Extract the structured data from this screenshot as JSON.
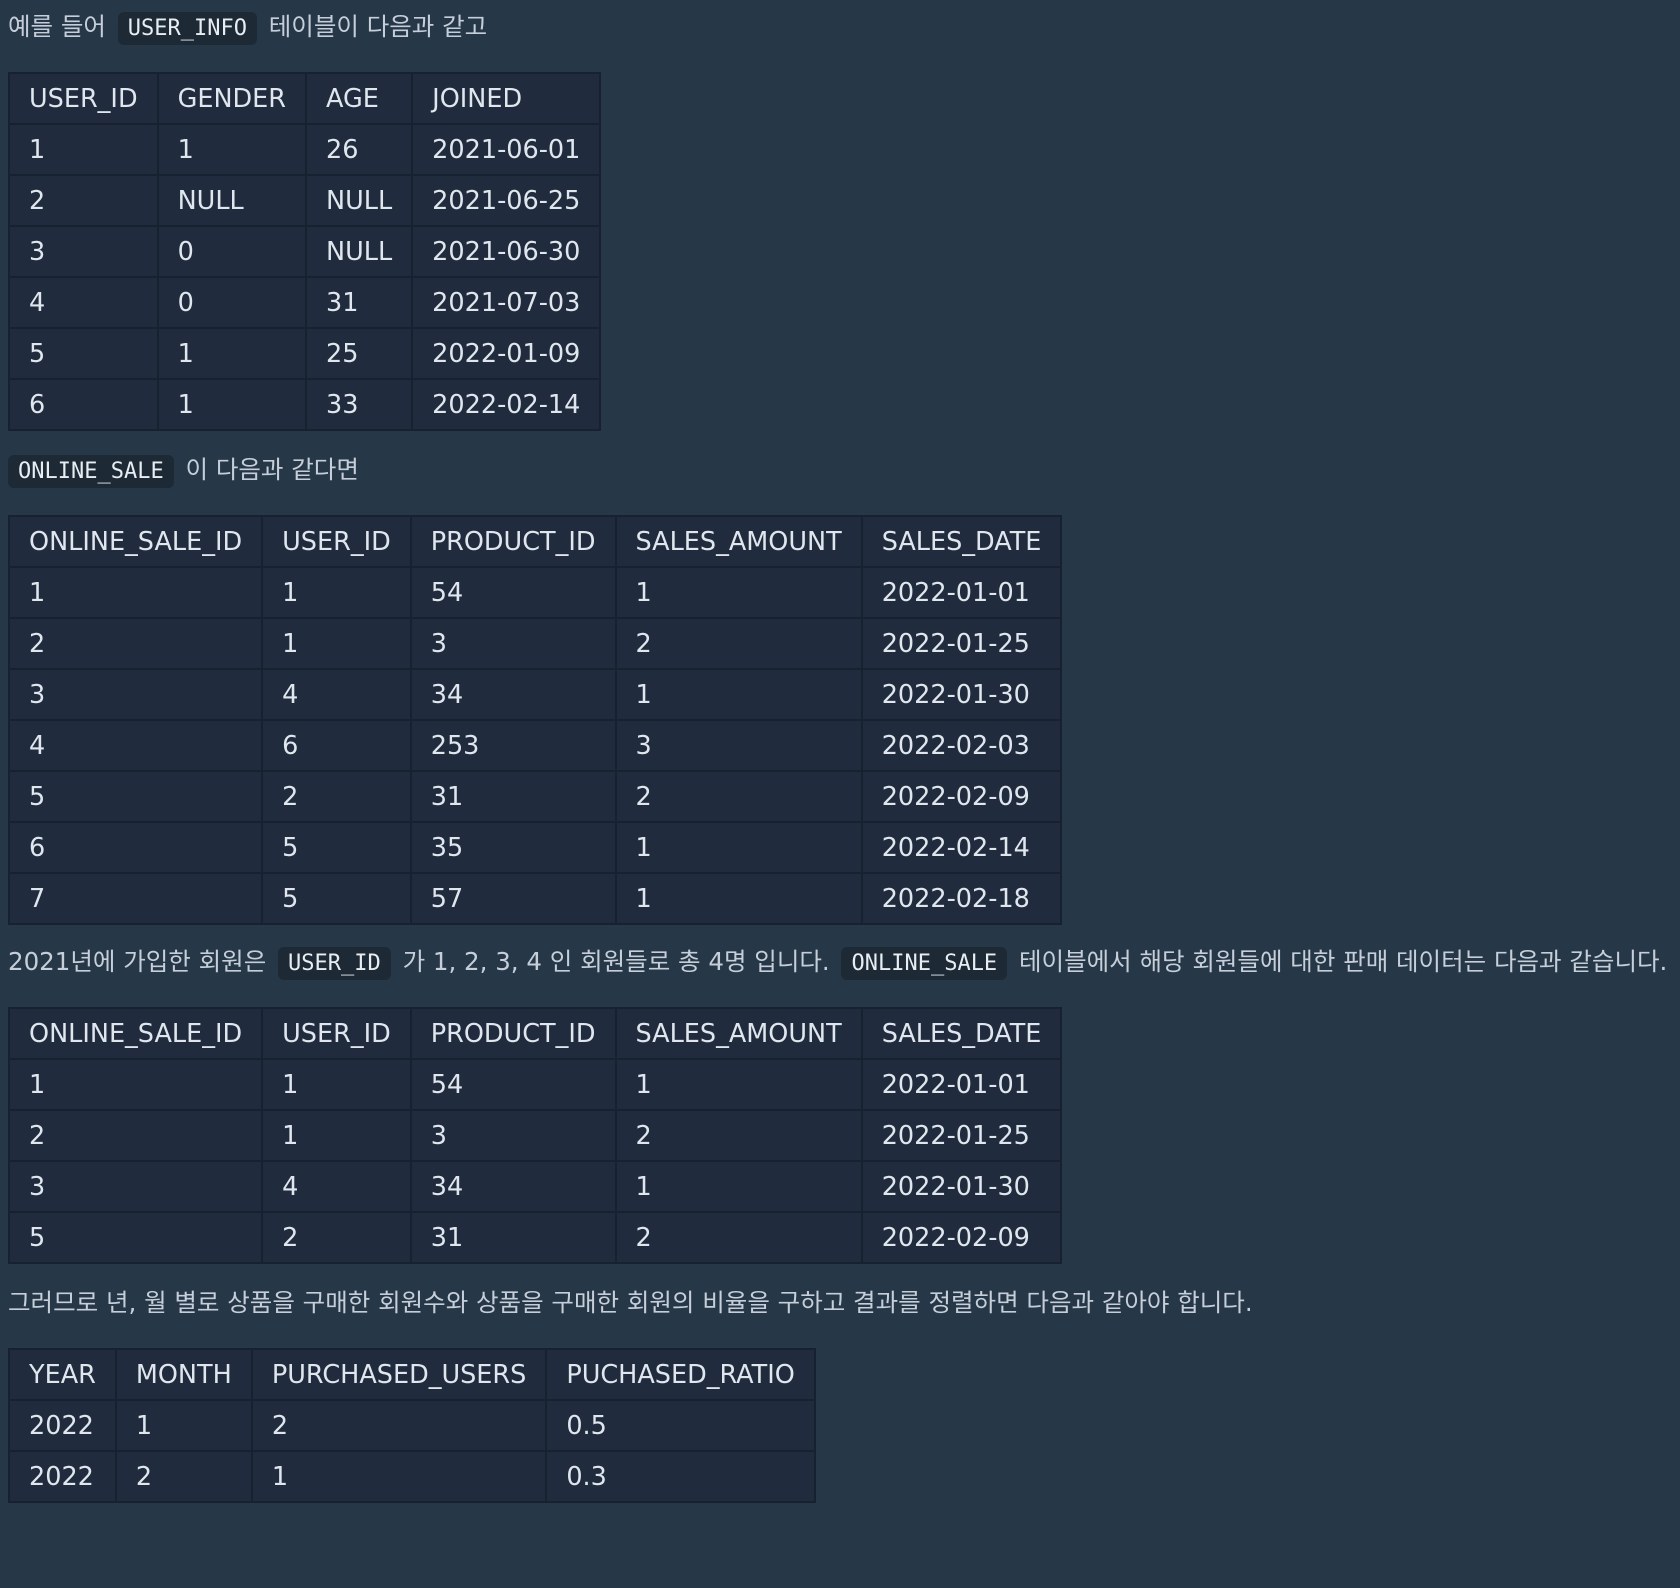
{
  "intro": {
    "prefix": "예를 들어",
    "code": "USER_INFO",
    "suffix": "테이블이 다음과 같고"
  },
  "user_info": {
    "headers": [
      "USER_ID",
      "GENDER",
      "AGE",
      "JOINED"
    ],
    "rows": [
      [
        "1",
        "1",
        "26",
        "2021-06-01"
      ],
      [
        "2",
        "NULL",
        "NULL",
        "2021-06-25"
      ],
      [
        "3",
        "0",
        "NULL",
        "2021-06-30"
      ],
      [
        "4",
        "0",
        "31",
        "2021-07-03"
      ],
      [
        "5",
        "1",
        "25",
        "2022-01-09"
      ],
      [
        "6",
        "1",
        "33",
        "2022-02-14"
      ]
    ]
  },
  "sale_intro": {
    "code": "ONLINE_SALE",
    "suffix": "이 다음과 같다면"
  },
  "online_sale": {
    "headers": [
      "ONLINE_SALE_ID",
      "USER_ID",
      "PRODUCT_ID",
      "SALES_AMOUNT",
      "SALES_DATE"
    ],
    "rows": [
      [
        "1",
        "1",
        "54",
        "1",
        "2022-01-01"
      ],
      [
        "2",
        "1",
        "3",
        "2",
        "2022-01-25"
      ],
      [
        "3",
        "4",
        "34",
        "1",
        "2022-01-30"
      ],
      [
        "4",
        "6",
        "253",
        "3",
        "2022-02-03"
      ],
      [
        "5",
        "2",
        "31",
        "2",
        "2022-02-09"
      ],
      [
        "6",
        "5",
        "35",
        "1",
        "2022-02-14"
      ],
      [
        "7",
        "5",
        "57",
        "1",
        "2022-02-18"
      ]
    ]
  },
  "filter_text": {
    "part1": "2021년에 가입한 회원은",
    "code1": "USER_ID",
    "part2": "가 1, 2, 3, 4 인 회원들로 총 4명 입니다.",
    "code2": "ONLINE_SALE",
    "part3": "테이블에서 해당 회원들에 대한 판매 데이터는 다음과 같습니다."
  },
  "filtered_sale": {
    "headers": [
      "ONLINE_SALE_ID",
      "USER_ID",
      "PRODUCT_ID",
      "SALES_AMOUNT",
      "SALES_DATE"
    ],
    "rows": [
      [
        "1",
        "1",
        "54",
        "1",
        "2022-01-01"
      ],
      [
        "2",
        "1",
        "3",
        "2",
        "2022-01-25"
      ],
      [
        "3",
        "4",
        "34",
        "1",
        "2022-01-30"
      ],
      [
        "5",
        "2",
        "31",
        "2",
        "2022-02-09"
      ]
    ]
  },
  "result_text": "그러므로 년, 월 별로 상품을 구매한 회원수와 상품을 구매한 회원의 비율을 구하고 결과를 정렬하면 다음과 같아야 합니다.",
  "result": {
    "headers": [
      "YEAR",
      "MONTH",
      "PURCHASED_USERS",
      "PUCHASED_RATIO"
    ],
    "rows": [
      [
        "2022",
        "1",
        "2",
        "0.5"
      ],
      [
        "2022",
        "2",
        "1",
        "0.3"
      ]
    ]
  }
}
